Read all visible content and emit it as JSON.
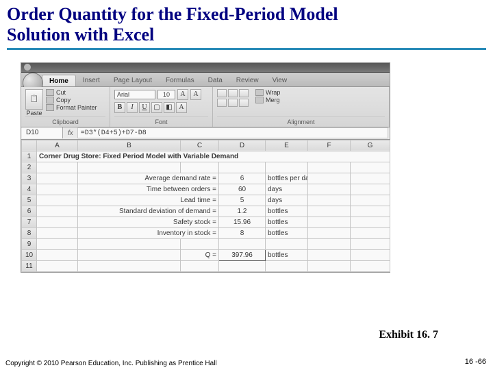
{
  "title_line1": "Order Quantity for the Fixed-Period Model",
  "title_line2": "Solution with Excel",
  "ribbon": {
    "tabs": [
      "Home",
      "Insert",
      "Page Layout",
      "Formulas",
      "Data",
      "Review",
      "View"
    ],
    "active_tab": "Home",
    "clipboard": {
      "paste": "Paste",
      "cut": "Cut",
      "copy": "Copy",
      "format_painter": "Format Painter",
      "group": "Clipboard"
    },
    "font": {
      "name": "Arial",
      "size": "10",
      "group": "Font"
    },
    "alignment": {
      "wrap": "Wrap",
      "merge": "Merg",
      "group": "Alignment"
    }
  },
  "formula_bar": {
    "name_box": "D10",
    "formula": "=D3*(D4+5)+D7-D8"
  },
  "columns": [
    "A",
    "B",
    "C",
    "D",
    "E",
    "F",
    "G"
  ],
  "sheet_title": "Corner Drug Store: Fixed Period Model with Variable Demand",
  "rows": [
    {
      "n": 3,
      "label": "Average demand rate =",
      "value": "6",
      "unit": "bottles per day"
    },
    {
      "n": 4,
      "label": "Time between orders =",
      "value": "60",
      "unit": "days"
    },
    {
      "n": 5,
      "label": "Lead time =",
      "value": "5",
      "unit": "days"
    },
    {
      "n": 6,
      "label": "Standard deviation of demand =",
      "value": "1.2",
      "unit": "bottles"
    },
    {
      "n": 7,
      "label": "Safety stock =",
      "value": "15.96",
      "unit": "bottles"
    },
    {
      "n": 8,
      "label": "Inventory in stock =",
      "value": "8",
      "unit": "bottles"
    }
  ],
  "result": {
    "n": 10,
    "label": "Q =",
    "value": "397.96",
    "unit": "bottles"
  },
  "blank_rows": [
    2,
    9,
    11
  ],
  "exhibit": "Exhibit 16. 7",
  "copyright": "Copyright © 2010 Pearson Education, Inc. Publishing as Prentice Hall",
  "page": "16 -66"
}
